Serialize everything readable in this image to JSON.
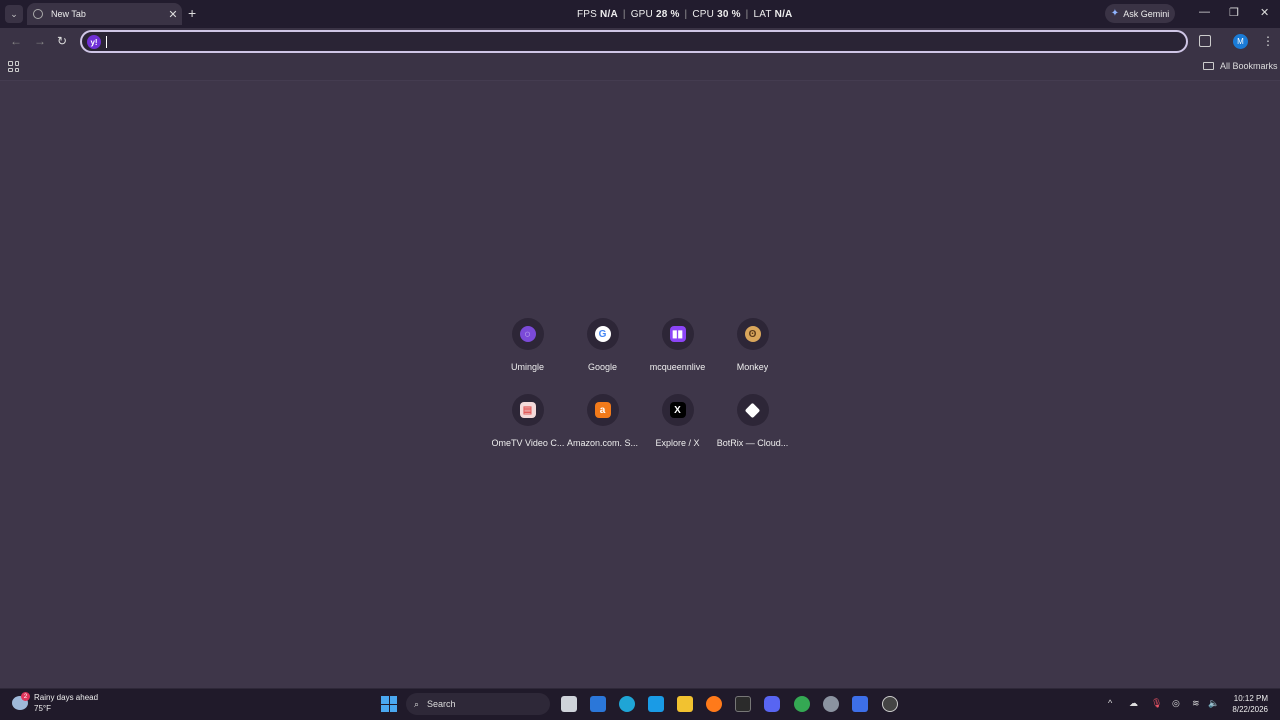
{
  "tabs": [
    {
      "label": "New Tab"
    }
  ],
  "perf": {
    "fps_label": "FPS",
    "fps_value": "N/A",
    "gpu_label": "GPU",
    "gpu_value": "28 %",
    "cpu_label": "CPU",
    "cpu_value": "30 %",
    "lat_label": "LAT",
    "lat_value": "N/A"
  },
  "gemini": {
    "label": "Ask Gemini"
  },
  "omnibox": {
    "value": "",
    "placeholder": ""
  },
  "profile": {
    "initial": "M"
  },
  "bookmarks": {
    "all_label": "All Bookmarks"
  },
  "shortcuts": [
    {
      "label": "Umingle",
      "color": "#7b4ad8",
      "glyph": "💬"
    },
    {
      "label": "Google",
      "color": "#ffffff",
      "glyph": "G"
    },
    {
      "label": "mcqueennlive",
      "color": "#8c45f7",
      "glyph": "▣"
    },
    {
      "label": "Monkey",
      "color": "#d9a65b",
      "glyph": "🐵"
    },
    {
      "label": "OmeTV Video C...",
      "color": "#e15a5a",
      "glyph": "▤"
    },
    {
      "label": "Amazon.com. S...",
      "color": "#f27a1a",
      "glyph": "a"
    },
    {
      "label": "Explore / X",
      "color": "#000000",
      "glyph": "X"
    },
    {
      "label": "BotRix — Cloud...",
      "color": "#ffffff",
      "glyph": "◆"
    }
  ],
  "taskbar": {
    "weather_line1": "Rainy days ahead",
    "weather_line2": "75°F",
    "weather_badge": "2",
    "search_label": "Search",
    "time": "10:12 PM",
    "date": "8/22/2026"
  }
}
